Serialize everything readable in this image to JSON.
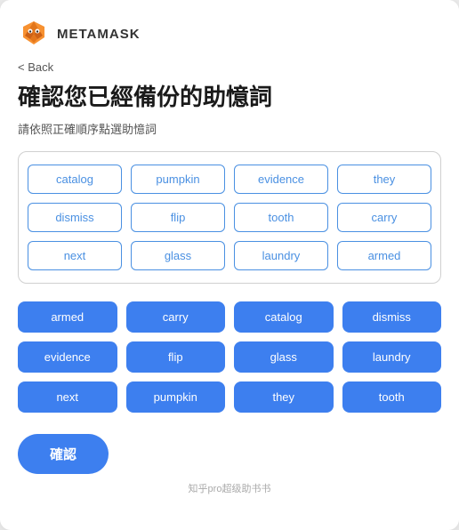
{
  "header": {
    "logo_alt": "metamask-fox",
    "title": "METAMASK"
  },
  "back": {
    "label": "< Back"
  },
  "page": {
    "title": "確認您已經備份的助憶詞",
    "subtitle": "請依照正確順序點選助憶詞"
  },
  "word_pool": {
    "words": [
      "catalog",
      "pumpkin",
      "evidence",
      "they",
      "dismiss",
      "flip",
      "tooth",
      "carry",
      "next",
      "glass",
      "laundry",
      "armed"
    ]
  },
  "selected_words": {
    "words": [
      "armed",
      "carry",
      "catalog",
      "dismiss",
      "evidence",
      "flip",
      "glass",
      "laundry",
      "next",
      "pumpkin",
      "they",
      "tooth"
    ]
  },
  "confirm_button": {
    "label": "確認"
  },
  "footer": {
    "text": "知乎pro超级助书书"
  }
}
